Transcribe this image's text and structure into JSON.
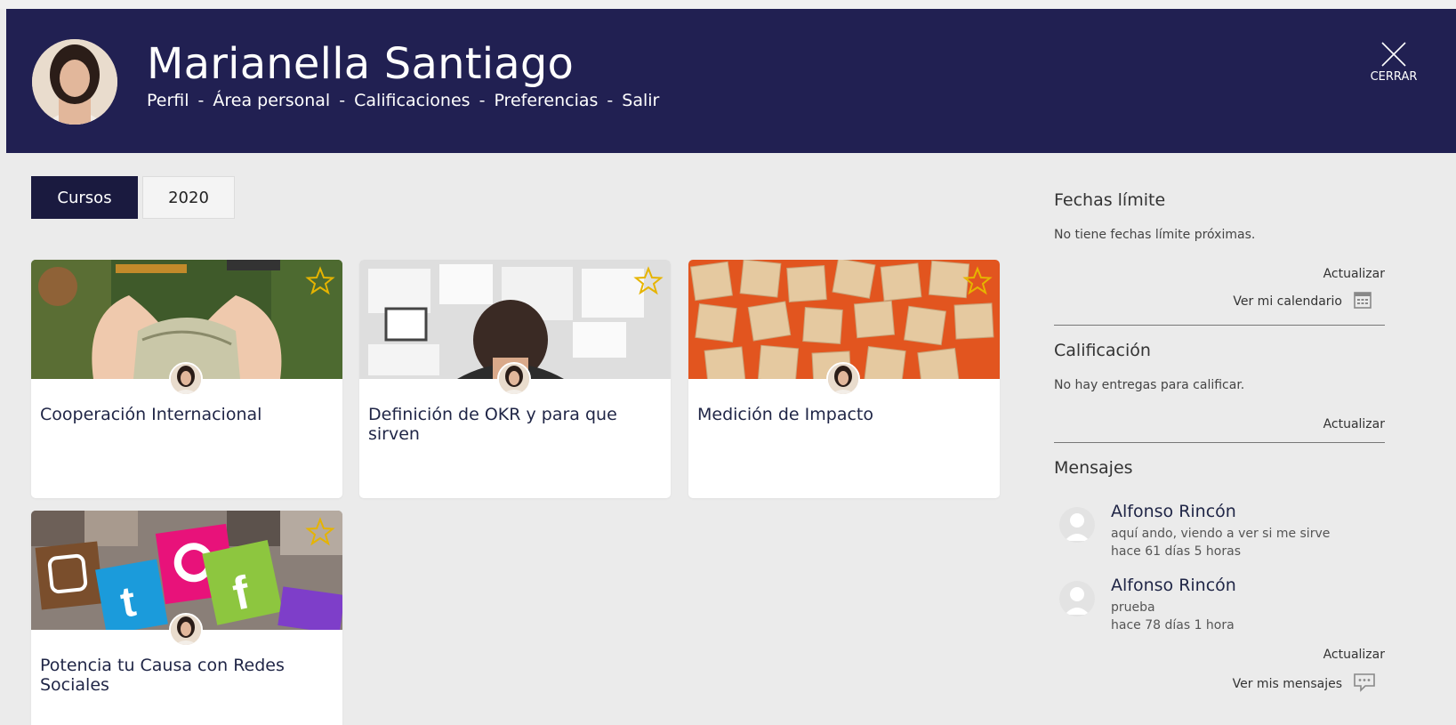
{
  "header": {
    "user_name": "Marianella Santiago",
    "nav": [
      "Perfil",
      "Área personal",
      "Calificaciones",
      "Preferencias",
      "Salir"
    ],
    "separator": "-",
    "close_label": "CERRAR"
  },
  "tabs": [
    "Cursos",
    "2020"
  ],
  "courses": [
    {
      "title": "Cooperación Internacional",
      "favorite": false
    },
    {
      "title": "Definición de OKR y para que sirven",
      "favorite": false
    },
    {
      "title": "Medición de Impacto",
      "favorite": false
    },
    {
      "title": "Potencia tu Causa con Redes Sociales",
      "favorite": false
    }
  ],
  "sidebar": {
    "deadlines": {
      "heading": "Fechas límite",
      "empty_text": "No tiene fechas límite próximas.",
      "refresh": "Actualizar",
      "calendar_link": "Ver mi calendario"
    },
    "grading": {
      "heading": "Calificación",
      "empty_text": "No hay entregas para calificar.",
      "refresh": "Actualizar"
    },
    "messages": {
      "heading": "Mensajes",
      "items": [
        {
          "from": "Alfonso Rincón",
          "text": "aquí ando, viendo a ver si me sirve",
          "time": "hace 61 días 5 horas"
        },
        {
          "from": "Alfonso Rincón",
          "text": "prueba",
          "time": "hace 78 días 1 hora"
        }
      ],
      "refresh": "Actualizar",
      "messages_link": "Ver mis mensajes"
    }
  },
  "colors": {
    "header_bg": "#212052",
    "tab_active_bg": "#1a1a3f",
    "star": "#e6b400",
    "page_bg": "#ebebeb"
  }
}
